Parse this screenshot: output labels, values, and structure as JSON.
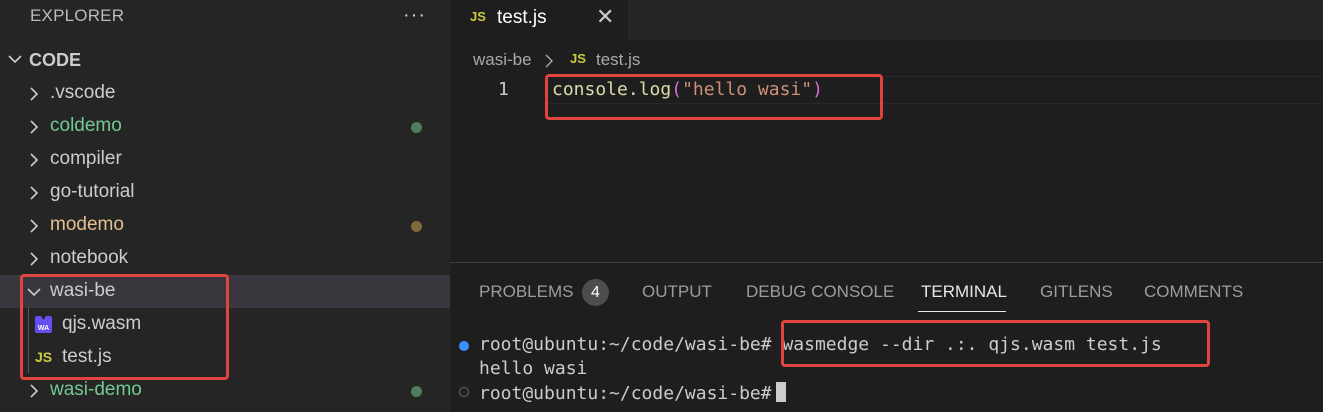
{
  "sidebar": {
    "header": "EXPLORER",
    "more_icon": "ellipsis-icon",
    "section_title": "CODE",
    "folders": [
      {
        "label": ".vscode",
        "status": "none"
      },
      {
        "label": "coldemo",
        "status": "untracked",
        "color": "#73c991"
      },
      {
        "label": "compiler",
        "status": "none"
      },
      {
        "label": "go-tutorial",
        "status": "none"
      },
      {
        "label": "modemo",
        "status": "modified",
        "color": "#e2c08d"
      },
      {
        "label": "notebook",
        "status": "none"
      },
      {
        "label": "wasi-be",
        "status": "expanded"
      },
      {
        "label": "wasi-demo",
        "status": "untracked",
        "color": "#73c991"
      }
    ],
    "files": [
      {
        "label": "qjs.wasm",
        "icon": "wasm-file-icon",
        "icon_text": "WA"
      },
      {
        "label": "test.js",
        "icon": "js-file-icon",
        "icon_text": "JS"
      }
    ]
  },
  "editor": {
    "tab": {
      "icon_text": "JS",
      "label": "test.js",
      "close": "✕"
    },
    "breadcrumb": {
      "folder": "wasi-be",
      "separator": "›",
      "icon_text": "JS",
      "file": "test.js"
    },
    "line_number": "1",
    "code": {
      "fn": "console.log",
      "open_paren": "(",
      "string": "\"hello wasi\"",
      "close_paren": ")"
    }
  },
  "panel": {
    "tabs": [
      "PROBLEMS",
      "OUTPUT",
      "DEBUG CONSOLE",
      "TERMINAL",
      "GITLENS",
      "COMMENTS"
    ],
    "active_tab": "TERMINAL",
    "problems_count": "4",
    "terminal": {
      "line1_prompt": "root@ubuntu:~/code/wasi-be#",
      "line1_cmd": "wasmedge --dir .:. qjs.wasm test.js",
      "line2": "hello wasi",
      "line3_prompt": "root@ubuntu:~/code/wasi-be#"
    }
  },
  "colors": {
    "highlight_box": "#e0443e",
    "untracked": "#73c991",
    "modified": "#e2c08d",
    "accent": "#3794ff"
  }
}
